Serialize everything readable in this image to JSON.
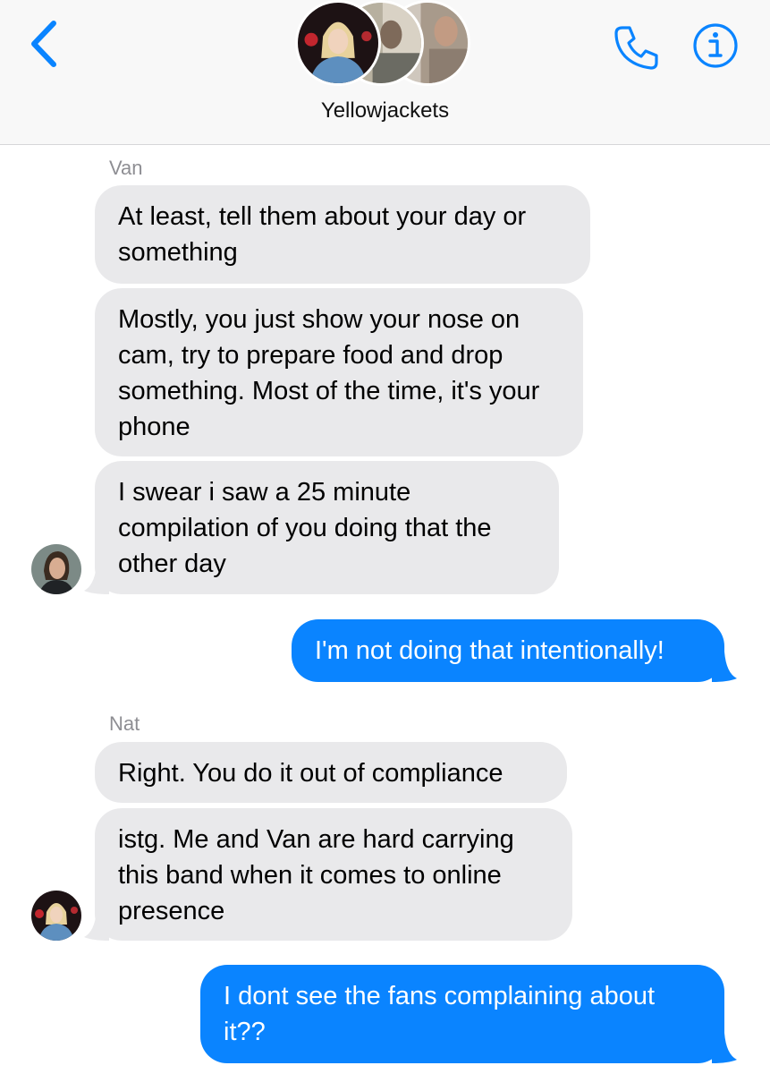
{
  "header": {
    "group_name": "Yellowjackets",
    "back_icon": "chevron-left-icon",
    "call_icon": "phone-icon",
    "info_icon": "info-icon",
    "accent_color": "#0a84ff"
  },
  "messages": [
    {
      "sender": "Van",
      "direction": "incoming",
      "text": "At least, tell them about your day or something"
    },
    {
      "direction": "incoming",
      "text": "Mostly, you just show your nose on cam, try to prepare food and drop something. Most of the time, it's your phone"
    },
    {
      "direction": "incoming",
      "text": "I swear i saw a 25 minute compilation of you doing that the other day"
    },
    {
      "direction": "outgoing",
      "text": "I'm not doing that intentionally!"
    },
    {
      "sender": "Nat",
      "direction": "incoming",
      "text": "Right. You do it out of compliance"
    },
    {
      "direction": "incoming",
      "text": "istg. Me and Van are hard carrying this band when it comes to online presence"
    },
    {
      "direction": "outgoing",
      "text": "I dont see the fans complaining about it??"
    }
  ]
}
